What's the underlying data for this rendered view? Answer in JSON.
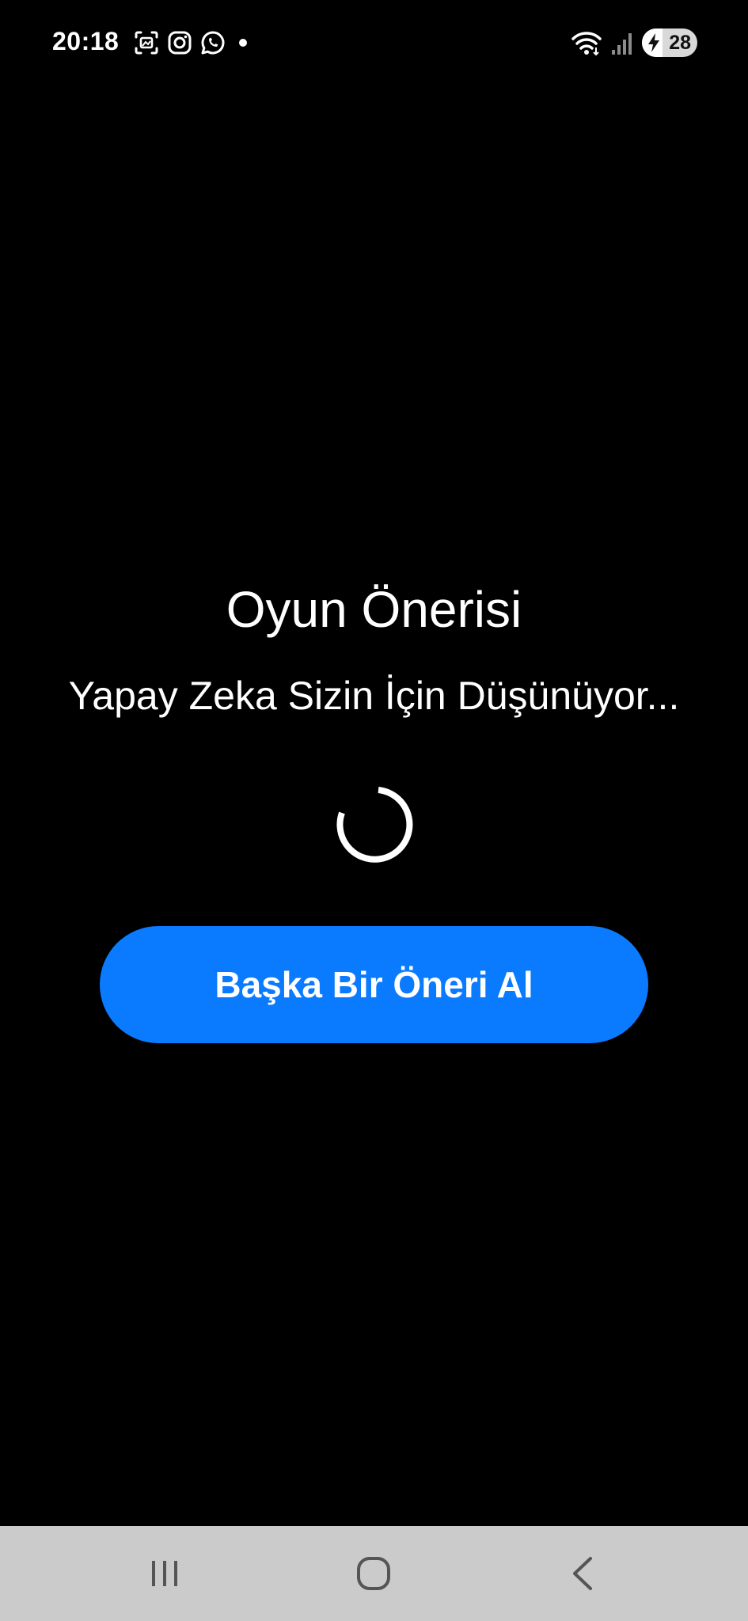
{
  "status_bar": {
    "time": "20:18",
    "notification_icons": [
      "screenshot-icon",
      "instagram-icon",
      "whatsapp-icon",
      "more-dot-icon"
    ],
    "system_icons": [
      "wifi-icon",
      "signal-icon",
      "charging-icon"
    ],
    "battery_level": "28"
  },
  "main": {
    "title": "Oyun Önerisi",
    "subtitle": "Yapay Zeka Sizin İçin Düşünüyor...",
    "loading_indicator": "spinner-icon",
    "button_label": "Başka Bir Öneri Al"
  },
  "navigation_bar": {
    "buttons": [
      "recent-apps-icon",
      "home-icon",
      "back-icon"
    ]
  },
  "colors": {
    "background": "#000000",
    "text": "#ffffff",
    "accent": "#0a7bff",
    "nav_bar": "#cbcbcb"
  }
}
